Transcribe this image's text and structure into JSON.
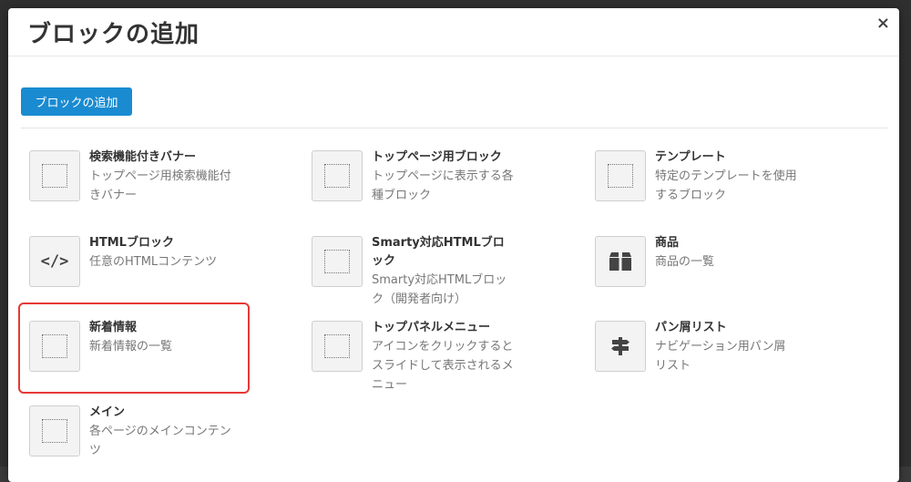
{
  "modal": {
    "title": "ブロックの追加",
    "close_label": "×",
    "add_button_label": "ブロックの追加"
  },
  "blocks": [
    {
      "title": "検索機能付きバナー",
      "desc": "トップページ用検索機能付きバナー",
      "icon": "dotted-square-icon"
    },
    {
      "title": "トップページ用ブロック",
      "desc": "トップページに表示する各種ブロック",
      "icon": "dotted-square-icon"
    },
    {
      "title": "テンプレート",
      "desc": "特定のテンプレートを使用するブロック",
      "icon": "dotted-square-icon"
    },
    {
      "title": "HTMLブロック",
      "desc": "任意のHTMLコンテンツ",
      "icon": "code-icon"
    },
    {
      "title": "Smarty対応HTMLブロック",
      "desc": "Smarty対応HTMLブロック（開発者向け）",
      "icon": "dotted-square-icon"
    },
    {
      "title": "商品",
      "desc": "商品の一覧",
      "icon": "box-icon"
    },
    {
      "title": "新着情報",
      "desc": "新着情報の一覧",
      "icon": "dotted-square-icon",
      "highlighted": true
    },
    {
      "title": "トップパネルメニュー",
      "desc": "アイコンをクリックするとスライドして表示されるメニュー",
      "icon": "dotted-square-icon"
    },
    {
      "title": "パン屑リスト",
      "desc": "ナビゲーション用パン屑リスト",
      "icon": "signpost-icon"
    },
    {
      "title": "メイン",
      "desc": "各ページのメインコンテンツ",
      "icon": "dotted-square-icon"
    }
  ],
  "colors": {
    "accent": "#1a8bd1",
    "highlight": "#e53935"
  }
}
